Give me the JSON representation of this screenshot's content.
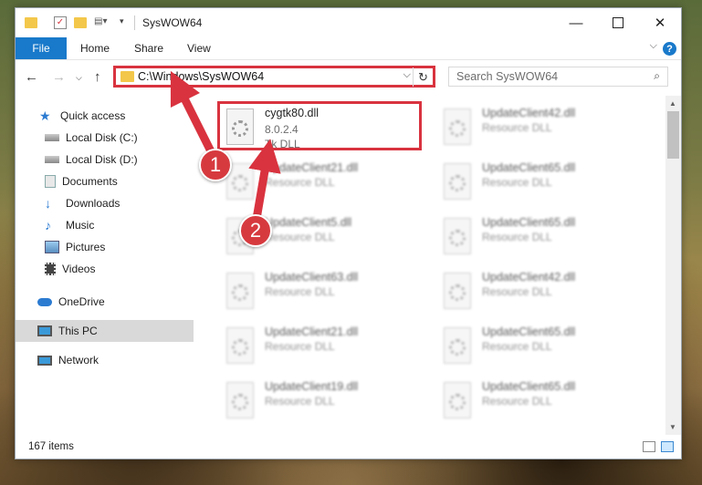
{
  "window": {
    "title": "SysWOW64",
    "minimize_icon": "minimize-icon",
    "maximize_icon": "maximize-icon",
    "close_icon": "close-icon"
  },
  "ribbon": {
    "tabs": [
      "File",
      "Home",
      "Share",
      "View"
    ],
    "help_label": "?"
  },
  "navbar": {
    "back_icon": "arrow-left-icon",
    "forward_icon": "arrow-right-icon",
    "recent_icon": "chevron-down-icon",
    "up_icon": "arrow-up-icon",
    "address": "C:\\Windows\\SysWOW64",
    "search_placeholder": "Search SysWOW64"
  },
  "sidebar": {
    "items": [
      {
        "label": "Quick access",
        "icon": "star-icon",
        "pinned": false
      },
      {
        "label": "Local Disk (C:)",
        "icon": "drive-icon",
        "pinned": true
      },
      {
        "label": "Local Disk (D:)",
        "icon": "drive-icon",
        "pinned": true
      },
      {
        "label": "Documents",
        "icon": "documents-icon",
        "pinned": true
      },
      {
        "label": "Downloads",
        "icon": "download-icon",
        "pinned": true
      },
      {
        "label": "Music",
        "icon": "music-icon",
        "pinned": true
      },
      {
        "label": "Pictures",
        "icon": "pictures-icon",
        "pinned": true
      },
      {
        "label": "Videos",
        "icon": "videos-icon",
        "pinned": true
      },
      {
        "label": "OneDrive",
        "icon": "cloud-icon",
        "pinned": false
      },
      {
        "label": "This PC",
        "icon": "computer-icon",
        "pinned": false
      },
      {
        "label": "Network",
        "icon": "network-icon",
        "pinned": false
      }
    ]
  },
  "files": [
    {
      "name": "cygtk80.dll",
      "line2": "8.0.2.4",
      "line3": "Tk DLL"
    },
    {
      "name": "UpdateClient42.dll",
      "line2": "Resource DLL"
    },
    {
      "name": "UpdateClient21.dll",
      "line2": "Resource DLL"
    },
    {
      "name": "UpdateClient65.dll",
      "line2": "Resource DLL"
    },
    {
      "name": "UpdateClient5.dll",
      "line2": "Resource DLL"
    },
    {
      "name": "UpdateClient65.dll",
      "line2": "Resource DLL"
    },
    {
      "name": "UpdateClient63.dll",
      "line2": "Resource DLL"
    },
    {
      "name": "UpdateClient42.dll",
      "line2": "Resource DLL"
    },
    {
      "name": "UpdateClient21.dll",
      "line2": "Resource DLL"
    },
    {
      "name": "UpdateClient65.dll",
      "line2": "Resource DLL"
    },
    {
      "name": "UpdateClient19.dll",
      "line2": "Resource DLL"
    },
    {
      "name": "UpdateClient65.dll",
      "line2": "Resource DLL"
    }
  ],
  "status": {
    "item_count": "167 items"
  },
  "annotations": {
    "step1": "1",
    "step2": "2",
    "accent_color": "#d9333f"
  }
}
